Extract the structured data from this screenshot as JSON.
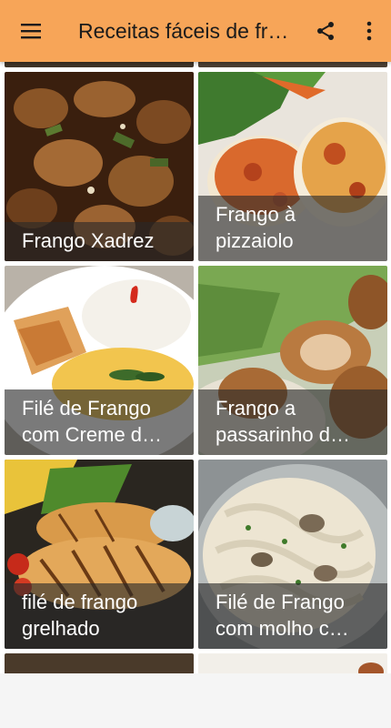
{
  "appbar": {
    "title": "Receitas fáceis de frango",
    "menu_icon": "hamburger-menu-icon",
    "share_icon": "share-icon",
    "more_icon": "more-vertical-icon",
    "color": "#f7a558"
  },
  "recipes": [
    {
      "line1": "Frango Xadrez",
      "line2": ""
    },
    {
      "line1": "Frango à",
      "line2": "pizzaiolo"
    },
    {
      "line1": "Filé de Frango",
      "line2": "com Creme d…"
    },
    {
      "line1": "Frango a",
      "line2": "passarinho d…"
    },
    {
      "line1": "filé de frango",
      "line2": "grelhado"
    },
    {
      "line1": "Filé de Frango",
      "line2": "com molho c…"
    }
  ]
}
